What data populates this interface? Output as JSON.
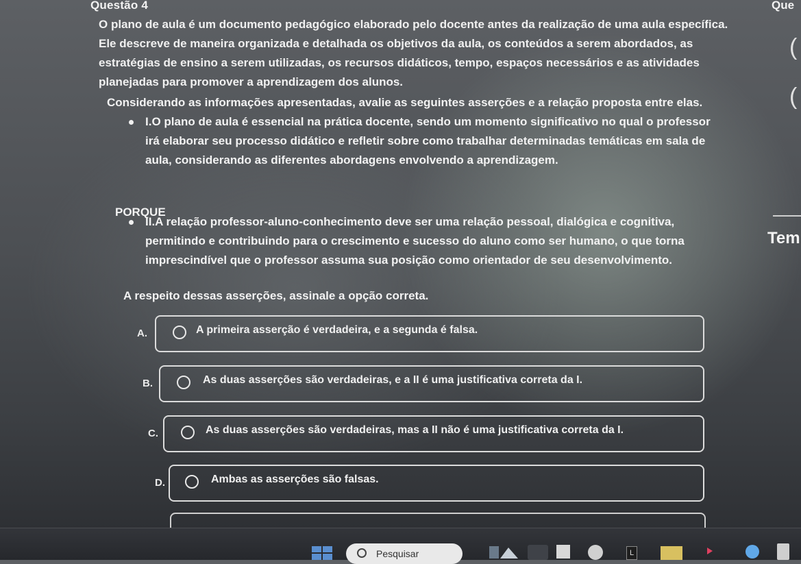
{
  "question": {
    "title": "Questão 4",
    "title_right": "Que",
    "statement": "O plano de aula é um documento pedagógico elaborado pelo docente antes da realização de uma aula específica. Ele descreve de maneira organizada e detalhada os objetivos da aula, os conteúdos a serem abordados, as estratégias de ensino a serem utilizadas, os recursos didáticos, tempo, espaços necessários e as atividades planejadas para promover a aprendizagem dos alunos.",
    "instruction": "Considerando as informações apresentadas, avalie as seguintes asserções e a relação proposta entre elas.",
    "assertion_1": "I.O plano de aula é essencial na prática docente, sendo um momento significativo no qual o professor irá elaborar seu processo didático e refletir sobre como trabalhar determinadas temáticas em sala de aula, considerando as diferentes abordagens envolvendo a aprendizagem.",
    "connector": "PORQUE",
    "assertion_2": "II.A relação professor-aluno-conhecimento deve ser uma relação pessoal, dialógica e cognitiva, permitindo e contribuindo para o crescimento e sucesso do aluno como ser humano, o que torna imprescindível que o professor assuma sua posição como orientador de seu desenvolvimento.",
    "prompt": "A respeito dessas asserções, assinale a opção correta.",
    "options": [
      {
        "letter": "A.",
        "text": "A primeira asserção é verdadeira, e a segunda é falsa."
      },
      {
        "letter": "B.",
        "text": "As duas asserções são verdadeiras, e a II é uma justificativa correta da I."
      },
      {
        "letter": "C.",
        "text": "As duas asserções são verdadeiras, mas a II não é uma justificativa correta da I."
      },
      {
        "letter": "D.",
        "text": "Ambas as asserções são falsas."
      }
    ]
  },
  "side_panel": {
    "tem_label": "Tem"
  },
  "taskbar": {
    "search_placeholder": "Pesquisar",
    "icons": [
      "windows-icon",
      "search-icon",
      "weather-icon",
      "task-view-icon",
      "browser-icon",
      "store-icon",
      "app-icon",
      "files-icon",
      "media-icon",
      "settings-icon",
      "calculator-icon"
    ]
  },
  "colors": {
    "text": "#f2f2f2",
    "option_border": "#dcdcdc",
    "taskbar": "#2c2e32"
  }
}
